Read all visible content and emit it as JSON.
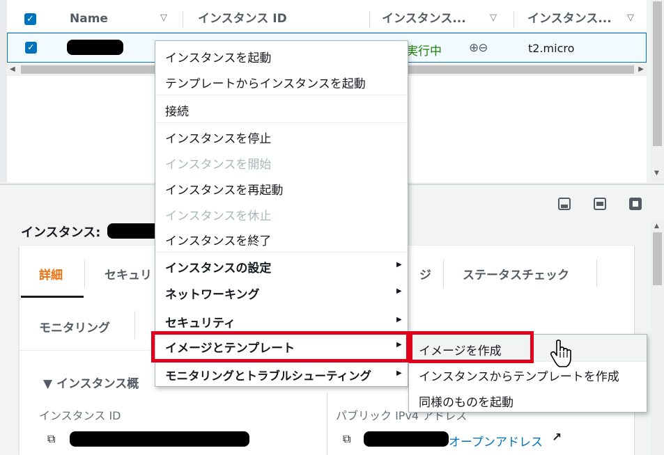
{
  "table": {
    "columns": [
      {
        "label": "Name"
      },
      {
        "label": "インスタンス ID"
      },
      {
        "label": "インスタンス..."
      },
      {
        "label": "インスタンス..."
      }
    ],
    "row": {
      "state": "実行中",
      "type": "t2.micro"
    },
    "sort_icon": "▽"
  },
  "detail": {
    "title": "インスタンス:",
    "tabs": [
      {
        "label": "詳細"
      },
      {
        "label": "セキュリ"
      },
      {
        "label": "ジ"
      },
      {
        "label": "ステータスチェック"
      },
      {
        "label": "モニタリング"
      }
    ],
    "section": "▼ インスタンス概",
    "field_instance_id": "インスタンス ID",
    "field_public_ipv4": "パブリック IPv4 アドレス",
    "open_address": "オープンアドレス"
  },
  "context_menu": {
    "items": [
      {
        "label": "インスタンスを起動"
      },
      {
        "label": "テンプレートからインスタンスを起動"
      },
      {
        "label": "接続"
      },
      {
        "label": "インスタンスを停止"
      },
      {
        "label": "インスタンスを開始"
      },
      {
        "label": "インスタンスを再起動"
      },
      {
        "label": "インスタンスを休止"
      },
      {
        "label": "インスタンスを終了"
      },
      {
        "label": "インスタンスの設定"
      },
      {
        "label": "ネットワーキング"
      },
      {
        "label": "セキュリティ"
      },
      {
        "label": "イメージとテンプレート"
      },
      {
        "label": "モニタリングとトラブルシューティング"
      }
    ],
    "submenu_arrow": "▶"
  },
  "submenu": {
    "items": [
      {
        "label": "イメージを作成"
      },
      {
        "label": "インスタンスからテンプレートを作成"
      },
      {
        "label": "同様のものを起動"
      }
    ]
  },
  "colors": {
    "highlight": "#e0001b",
    "accent": "#0073bb",
    "running": "#1d8102",
    "active_tab": "#ec7211"
  }
}
